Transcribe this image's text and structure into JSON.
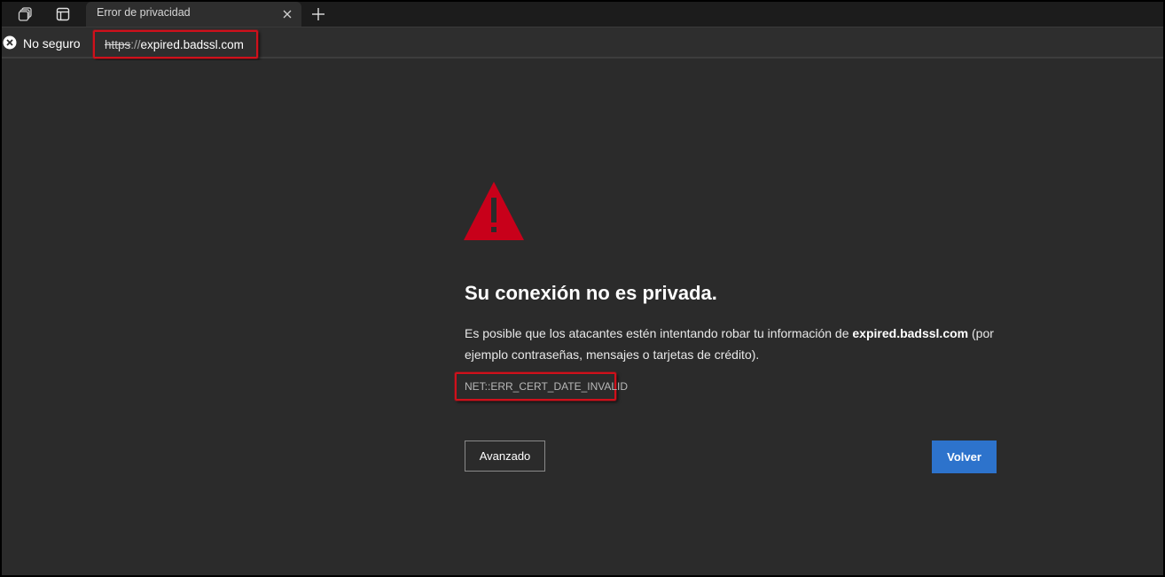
{
  "tab": {
    "title": "Error de privacidad"
  },
  "address_bar": {
    "security_label": "No seguro",
    "url_scheme": "https",
    "url_separator": "://",
    "url_host": "expired.badssl.com"
  },
  "error_page": {
    "heading": "Su conexión no es privada.",
    "message_before": "Es posible que los atacantes estén intentando robar tu información de ",
    "message_host": "expired.badssl.com",
    "message_after": " (por ejemplo contraseñas, mensajes o tarjetas de crédito).",
    "error_code": "NET::ERR_CERT_DATE_INVALID",
    "advanced_button": "Avanzado",
    "back_button": "Volver"
  },
  "colors": {
    "warning_red": "#c8001a",
    "highlight_red": "#d0101b",
    "primary_button": "#2d73cc",
    "page_background": "#2b2b2b"
  },
  "icons": {
    "workspaces": "workspaces-icon",
    "tab_actions": "tab-actions-icon",
    "close_tab": "close-icon",
    "new_tab": "plus-icon",
    "security": "not-secure-icon",
    "warning": "warning-triangle-icon"
  }
}
